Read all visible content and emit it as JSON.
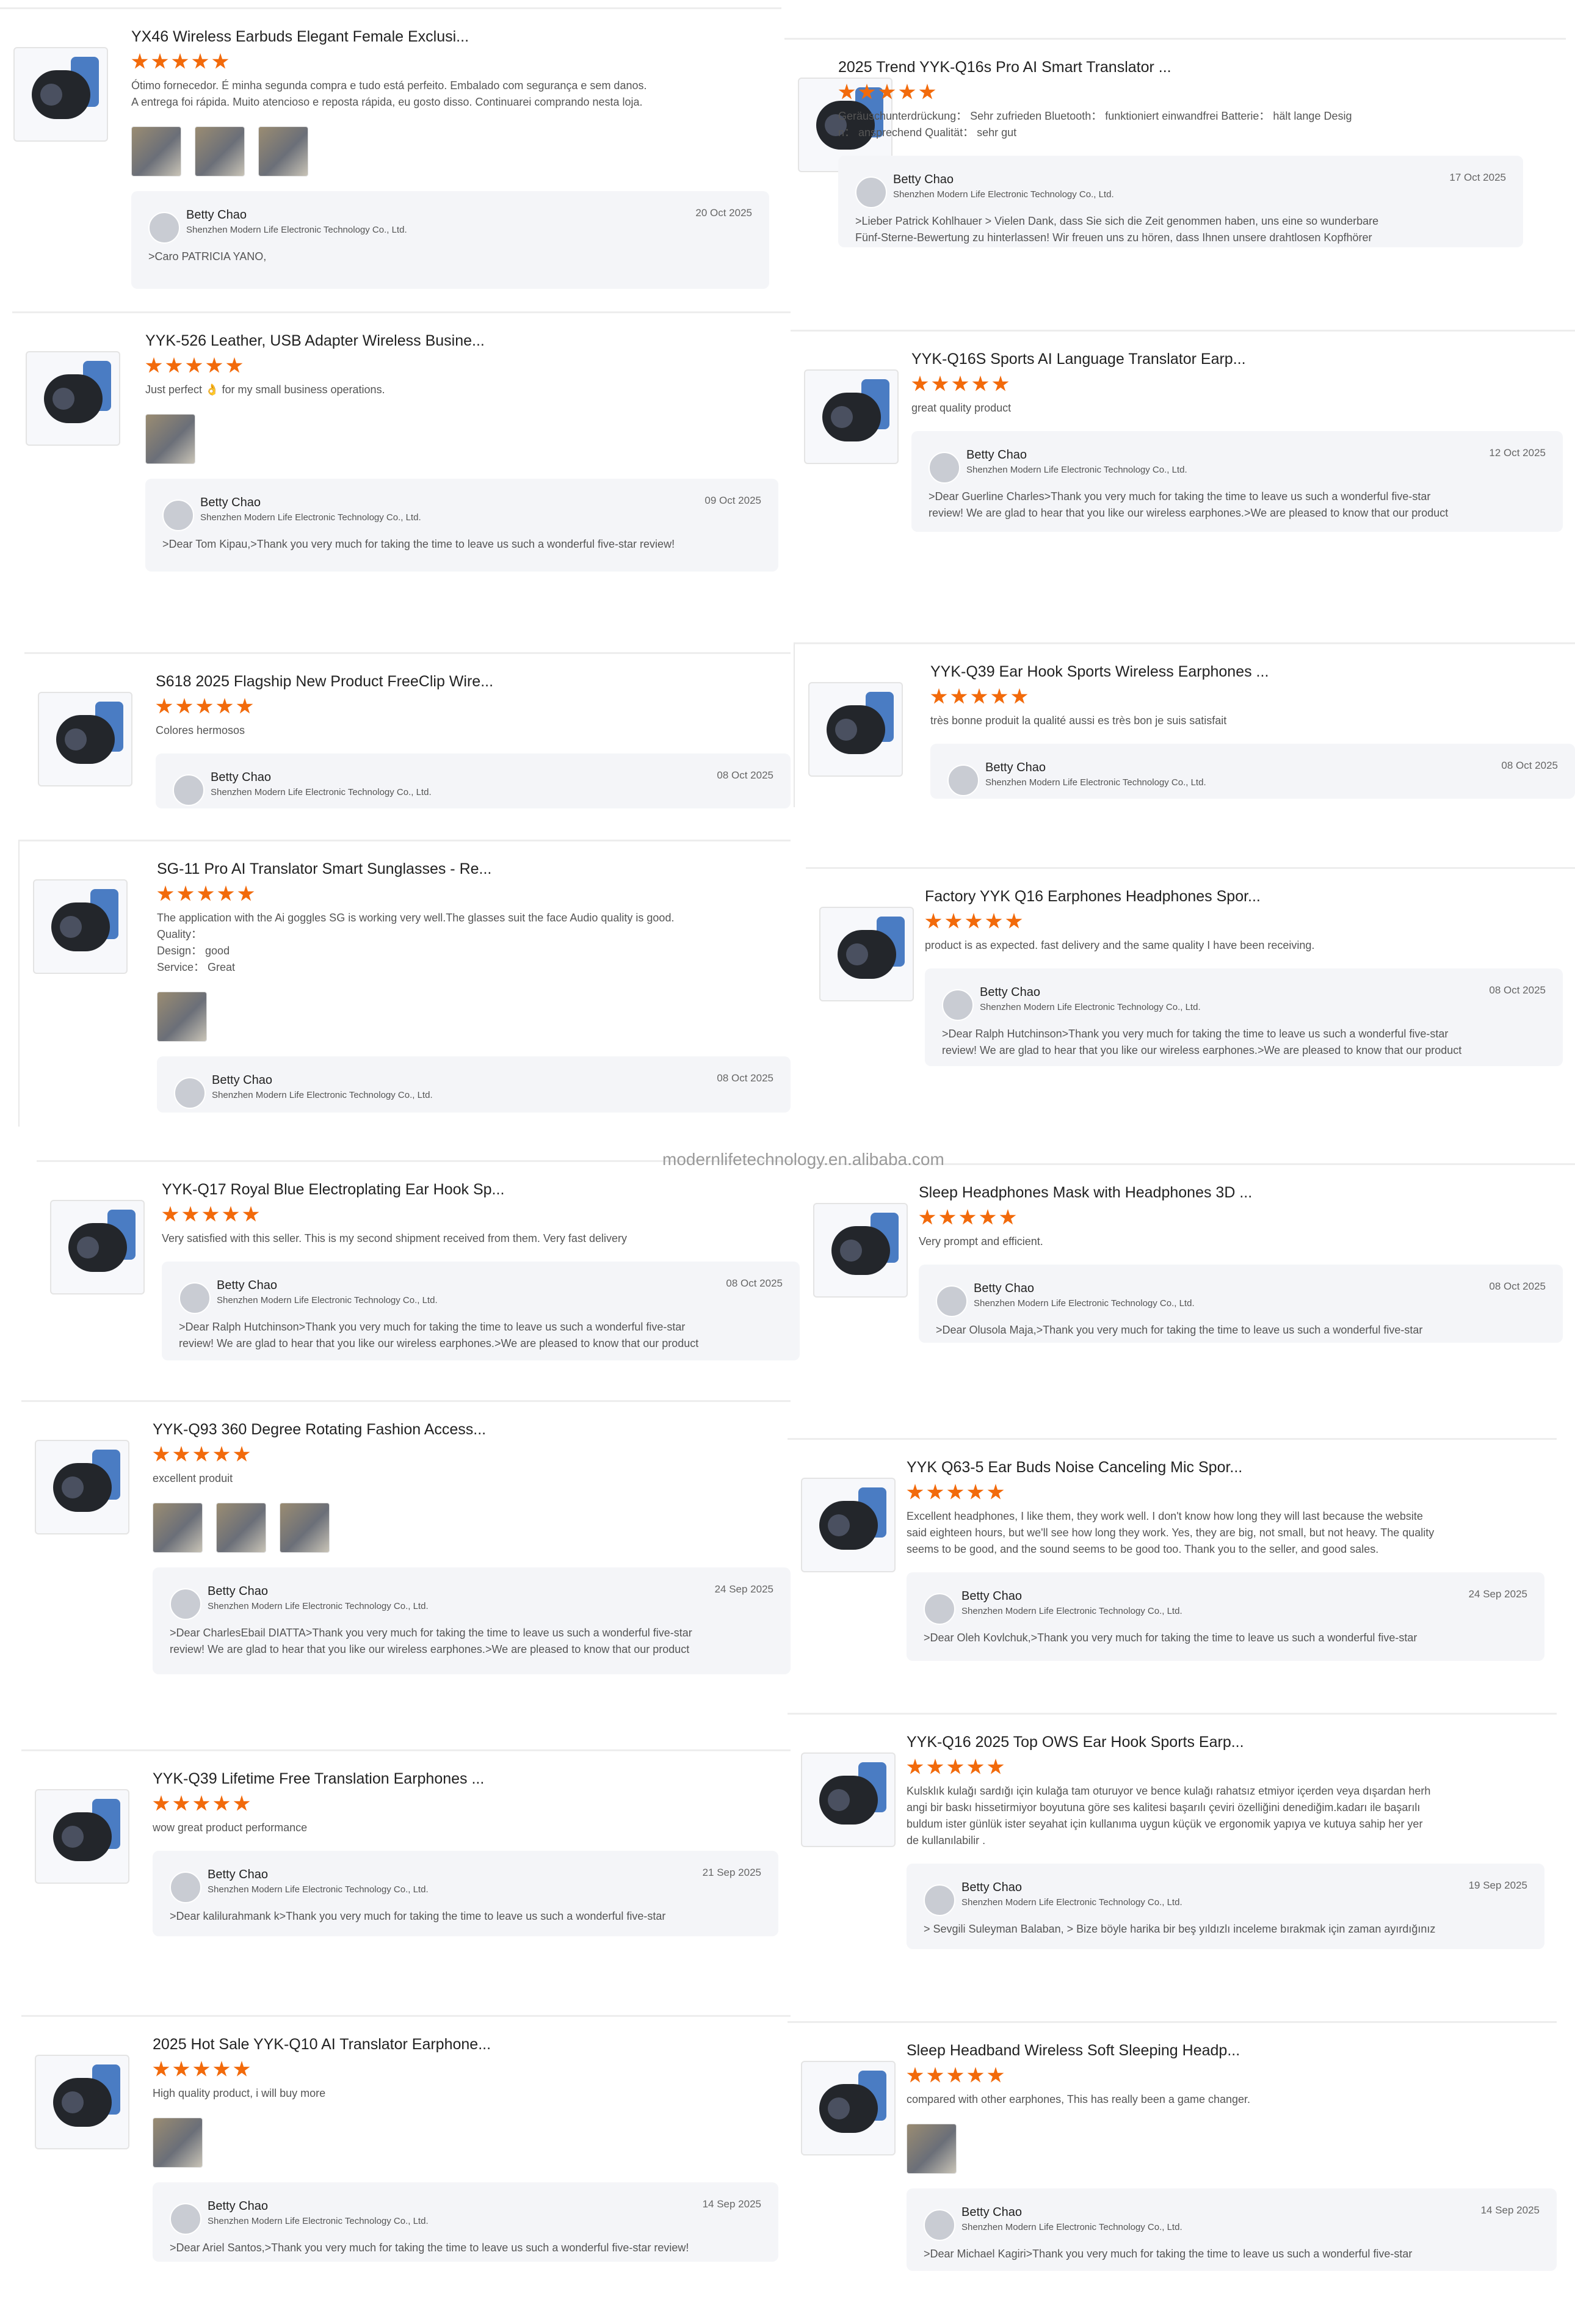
{
  "watermark": "modernlifetechnology.en.alibaba.com",
  "reply_name": "Betty Chao",
  "reply_company": "Shenzhen Modern Life Electronic Technology Co., Ltd.",
  "star_color": "#f26a0b",
  "rating_stars": 5,
  "reviews": [
    {
      "title": "YX46 Wireless Earbuds Elegant Female Exclusi...",
      "text": "Ótimo fornecedor. É minha segunda compra e tudo está perfeito. Embalado com segurança e sem danos.\nA entrega foi rápida. Muito atencioso e reposta rápida, eu gosto disso. Continuarei comprando nesta loja.",
      "photos": 3,
      "date": "20 Oct 2025",
      "reply": ">Caro PATRICIA YANO,"
    },
    {
      "title": "2025 Trend YYK-Q16s Pro AI Smart Translator ...",
      "text": "Geräuschunterdrückung： Sehr zufrieden Bluetooth： funktioniert einwandfrei Batterie： hält lange Desig\nn： ansprechend Qualität： sehr gut",
      "photos": 0,
      "date": "17 Oct 2025",
      "reply": ">Lieber Patrick Kohlhauer > Vielen Dank, dass Sie sich die Zeit genommen haben, uns eine so wunderbare\nFünf-Sterne-Bewertung zu hinterlassen! Wir freuen uns zu hören, dass Ihnen unsere drahtlosen Kopfhörer"
    },
    {
      "title": "YYK-526 Leather, USB Adapter Wireless Busine...",
      "text": "Just perfect 👌 for my small business operations.",
      "photos": 1,
      "date": "09 Oct 2025",
      "reply": ">Dear  Tom Kipau,>Thank you very much for taking the time to leave us such a wonderful five-star review!"
    },
    {
      "title": "YYK-Q16S Sports AI Language Translator Earp...",
      "text": "great quality product",
      "photos": 0,
      "date": "12 Oct 2025",
      "reply": ">Dear  Guerline Charles>Thank you very much for taking the time to leave us such a wonderful five-star\nreview! We are glad to hear that you like our wireless earphones.>We are pleased to know that our product"
    },
    {
      "title": "S618 2025 Flagship New Product FreeClip Wire...",
      "text": "Colores hermosos",
      "photos": 0,
      "date": "08 Oct 2025",
      "reply": ""
    },
    {
      "title": "YYK-Q39 Ear Hook Sports Wireless Earphones ...",
      "text": "très bonne produit la qualité aussi es très bon je suis satisfait",
      "photos": 0,
      "date": "08 Oct 2025",
      "reply": ""
    },
    {
      "title": "SG-11 Pro AI Translator Smart Sunglasses - Re...",
      "text": "The application with the Ai goggles SG is working very well.The glasses suit the face Audio quality is good.\nQuality：\nDesign： good\nService： Great",
      "photos": 1,
      "date": "08 Oct 2025",
      "reply": ""
    },
    {
      "title": "Factory YYK Q16 Earphones Headphones Spor...",
      "text": "product is as expected. fast delivery and the same quality I have been receiving.",
      "photos": 0,
      "date": "08 Oct 2025",
      "reply": ">Dear  Ralph Hutchinson>Thank you very much for taking the time to leave us such a wonderful five-star\nreview! We are glad to hear that you like our wireless earphones.>We are pleased to know that our product"
    },
    {
      "title": "YYK-Q17 Royal Blue Electroplating Ear Hook Sp...",
      "text": "Very satisfied with this seller. This is my second shipment received from them. Very fast delivery",
      "photos": 0,
      "date": "08 Oct 2025",
      "reply": ">Dear  Ralph Hutchinson>Thank you very much for taking the time to leave us such a wonderful five-star\nreview! We are glad to hear that you like our wireless earphones.>We are pleased to know that our product"
    },
    {
      "title": "Sleep Headphones Mask with Headphones 3D ...",
      "text": "Very prompt and efficient.",
      "photos": 0,
      "date": "08 Oct 2025",
      "reply": ">Dear  Olusola Maja,>Thank you very much for taking the time to leave us such a wonderful five-star"
    },
    {
      "title": "YYK-Q93 360 Degree Rotating Fashion Access...",
      "text": "excellent produit",
      "photos": 3,
      "date": "24 Sep 2025",
      "reply": ">Dear  CharlesEbail DIATTA>Thank you very much for taking the time to leave us such a wonderful five-star\nreview! We are glad to hear that you like our wireless earphones.>We are pleased to know that our product"
    },
    {
      "title": "YYK Q63-5 Ear Buds Noise Canceling Mic Spor...",
      "text": "Excellent headphones, I like them, they work well. I don't know how long they will last because the website\nsaid eighteen hours, but we'll see how long they work. Yes, they are big, not small, but not heavy. The quality\nseems to be good, and the sound seems to be good too. Thank you to the seller, and good sales.",
      "photos": 0,
      "date": "24 Sep 2025",
      "reply": ">Dear  Oleh Kovlchuk,>Thank you very much for taking the time to leave us such a wonderful five-star"
    },
    {
      "title": "YYK-Q39 Lifetime Free Translation Earphones ...",
      "text": "wow great product performance",
      "photos": 0,
      "date": "21 Sep 2025",
      "reply": ">Dear  kalilurahmank k>Thank you very much for taking the time to leave us such a wonderful five-star"
    },
    {
      "title": "YYK-Q16 2025 Top OWS Ear Hook Sports Earp...",
      "text": "Kulsklık kulağı sardığı için kulağa tam oturuyor ve bence kulağı rahatsız etmiyor içerden veya dışardan herh\nangi bir baskı hissetirmiyor boyutuna göre ses kalitesi başarılı çeviri özelliğini denediğim.kadarı ile başarılı\nbuldum ister günlük ister seyahat için kullanıma uygun küçük ve ergonomik yapıya ve kutuya sahip her yer\nde kullanılabilir .",
      "photos": 0,
      "date": "19 Sep 2025",
      "reply": "> Sevgili Suleyman Balaban, > Bize böyle harika bir beş yıldızlı inceleme bırakmak için zaman ayırdığınız"
    },
    {
      "title": "2025 Hot Sale YYK-Q10 AI Translator Earphone...",
      "text": "High quality product, i will buy more",
      "photos": 1,
      "date": "14 Sep 2025",
      "reply": ">Dear Ariel Santos,>Thank you very much for taking the time to leave us such a wonderful five-star review!"
    },
    {
      "title": "Sleep Headband Wireless Soft Sleeping Headp...",
      "text": "compared with other earphones, This has really been a game changer.",
      "photos": 1,
      "date": "14 Sep 2025",
      "reply": ">Dear Michael Kagiri>Thank you very much for taking the time to leave us such a wonderful five-star"
    }
  ]
}
